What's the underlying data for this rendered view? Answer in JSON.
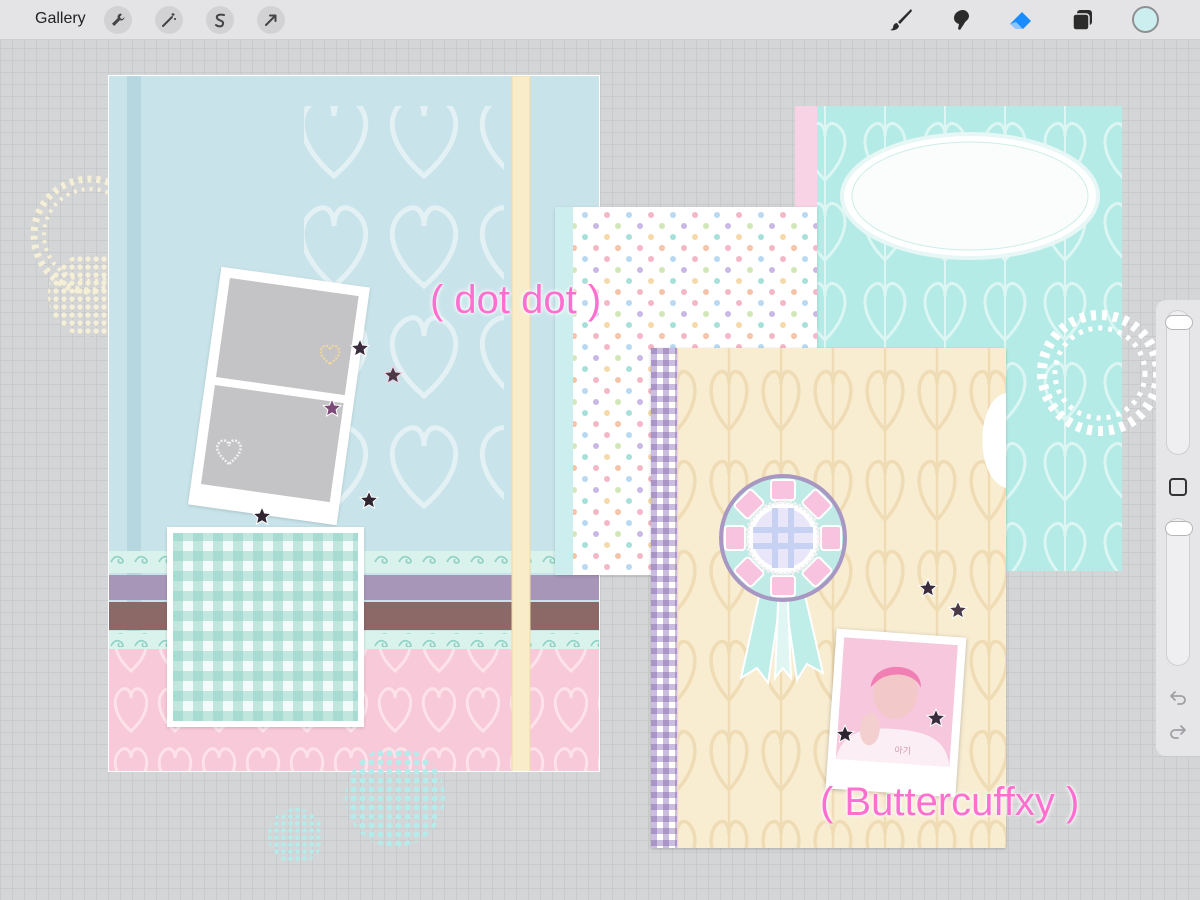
{
  "toolbar": {
    "gallery_label": "Gallery",
    "left_tools": [
      "wrench-icon",
      "magic-wand-icon",
      "selection-icon",
      "move-arrow-icon"
    ],
    "right_tools": [
      "brush-icon",
      "smudge-icon",
      "eraser-icon",
      "layers-icon"
    ],
    "active_tool": "eraser-icon",
    "current_color": "#cdeeee",
    "accent_color": "#1a8cff"
  },
  "canvas": {
    "text_dotdot": "( dot dot )",
    "text_credit": "( Buttercuffxy )",
    "text_color": "#ff6fcf",
    "photo_caption": "아기"
  },
  "colors": {
    "blue_page": "#c8e3ea",
    "pink_lace": "#f8c9d8",
    "mint_page": "#b5ebe6",
    "cream_page": "#f8ecd1",
    "purple_gingham": "#b7a6cc",
    "stripe_purple": "#a896b8",
    "stripe_brown": "#8c6967"
  }
}
